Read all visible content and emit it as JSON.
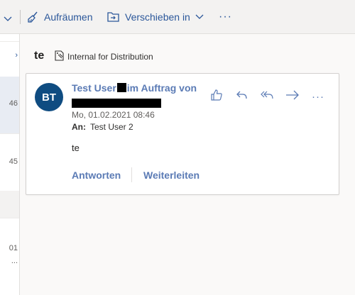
{
  "toolbar": {
    "cleanup_label": "Aufräumen",
    "move_label": "Verschieben in",
    "more_label": "···"
  },
  "list": {
    "times": [
      "46",
      "45",
      "01",
      "..."
    ]
  },
  "reading": {
    "subject": "te",
    "sensitivity_label": "Internal for Distribution",
    "message": {
      "avatar_initials": "BT",
      "sender_part1": "Test User",
      "sender_part2": "im Auftrag von",
      "date": "Mo, 01.02.2021 08:46",
      "to_label": "An:",
      "to_value": "Test User 2",
      "body": "te",
      "reply_label": "Antworten",
      "forward_label": "Weiterleiten",
      "more_label": "···"
    }
  },
  "colors": {
    "accent": "#2b579a",
    "link": "#5b7bb5",
    "avatar": "#0f4c81"
  }
}
